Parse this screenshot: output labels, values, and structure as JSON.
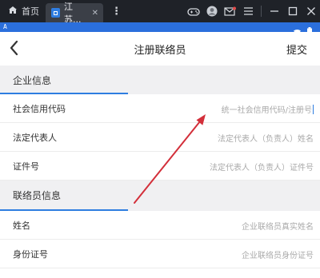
{
  "emulator": {
    "home_tab_label": "首页",
    "app_tab_label": "江苏...",
    "close_glyph": "✕",
    "kebab_glyph": "⋮"
  },
  "status_bar": {
    "left_text": "A"
  },
  "nav": {
    "title": "注册联络员",
    "submit_label": "提交"
  },
  "sections": {
    "company": {
      "title": "企业信息"
    },
    "contact": {
      "title": "联络员信息"
    }
  },
  "fields": {
    "credit_code": {
      "label": "社会信用代码",
      "placeholder": "统一社会信用代码/注册号"
    },
    "legal_rep": {
      "label": "法定代表人",
      "placeholder": "法定代表人（负责人）姓名"
    },
    "id_number": {
      "label": "证件号",
      "placeholder": "法定代表人（负责人）证件号"
    },
    "name": {
      "label": "姓名",
      "placeholder": "企业联络员真实姓名"
    },
    "id_card": {
      "label": "身份证号",
      "placeholder": "企业联络员身份证号"
    }
  },
  "colors": {
    "accent": "#2e7de0",
    "status_bar": "#2b6fdc",
    "annotation_arrow": "#d32f3a"
  }
}
